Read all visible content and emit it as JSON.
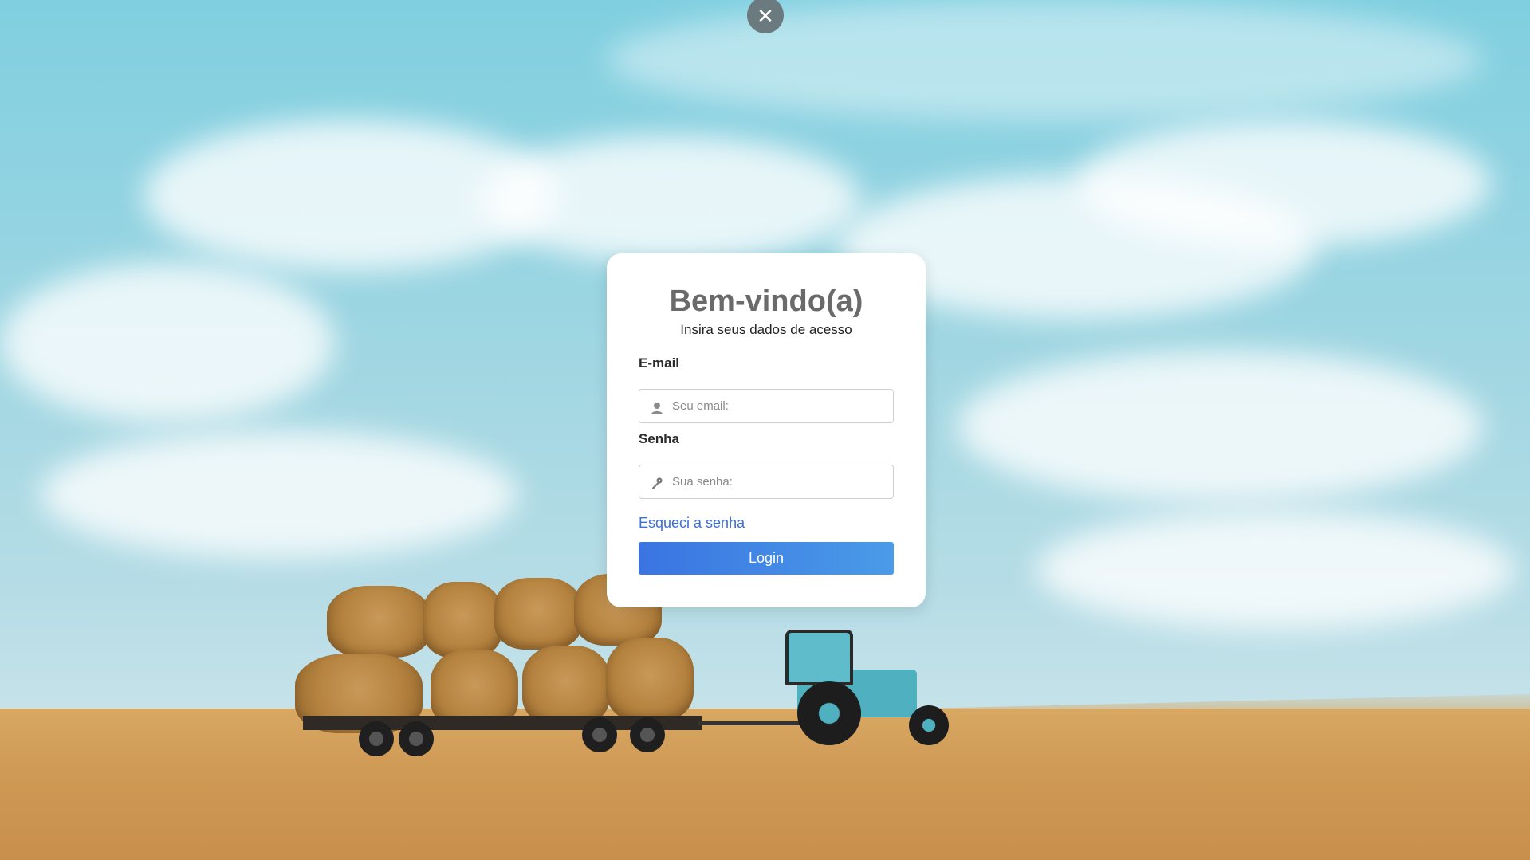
{
  "modal": {
    "close_icon": "close-icon",
    "close_glyph": "✕"
  },
  "login": {
    "title": "Bem-vindo(a)",
    "subtitle": "Insira seus dados de acesso",
    "email": {
      "label": "E-mail",
      "placeholder": "Seu email:",
      "value": "",
      "icon": "user-icon"
    },
    "password": {
      "label": "Senha",
      "placeholder": "Sua senha:",
      "value": "",
      "icon": "key-icon"
    },
    "forgot_label": "Esqueci a senha",
    "submit_label": "Login"
  },
  "background": {
    "image": "tractor-with-hay-bales-field",
    "colors": {
      "sky": "#8fd3e0",
      "field": "#d4a560",
      "button_start": "#3a74e2",
      "button_end": "#4a9be8",
      "link": "#3b6fd8"
    }
  }
}
